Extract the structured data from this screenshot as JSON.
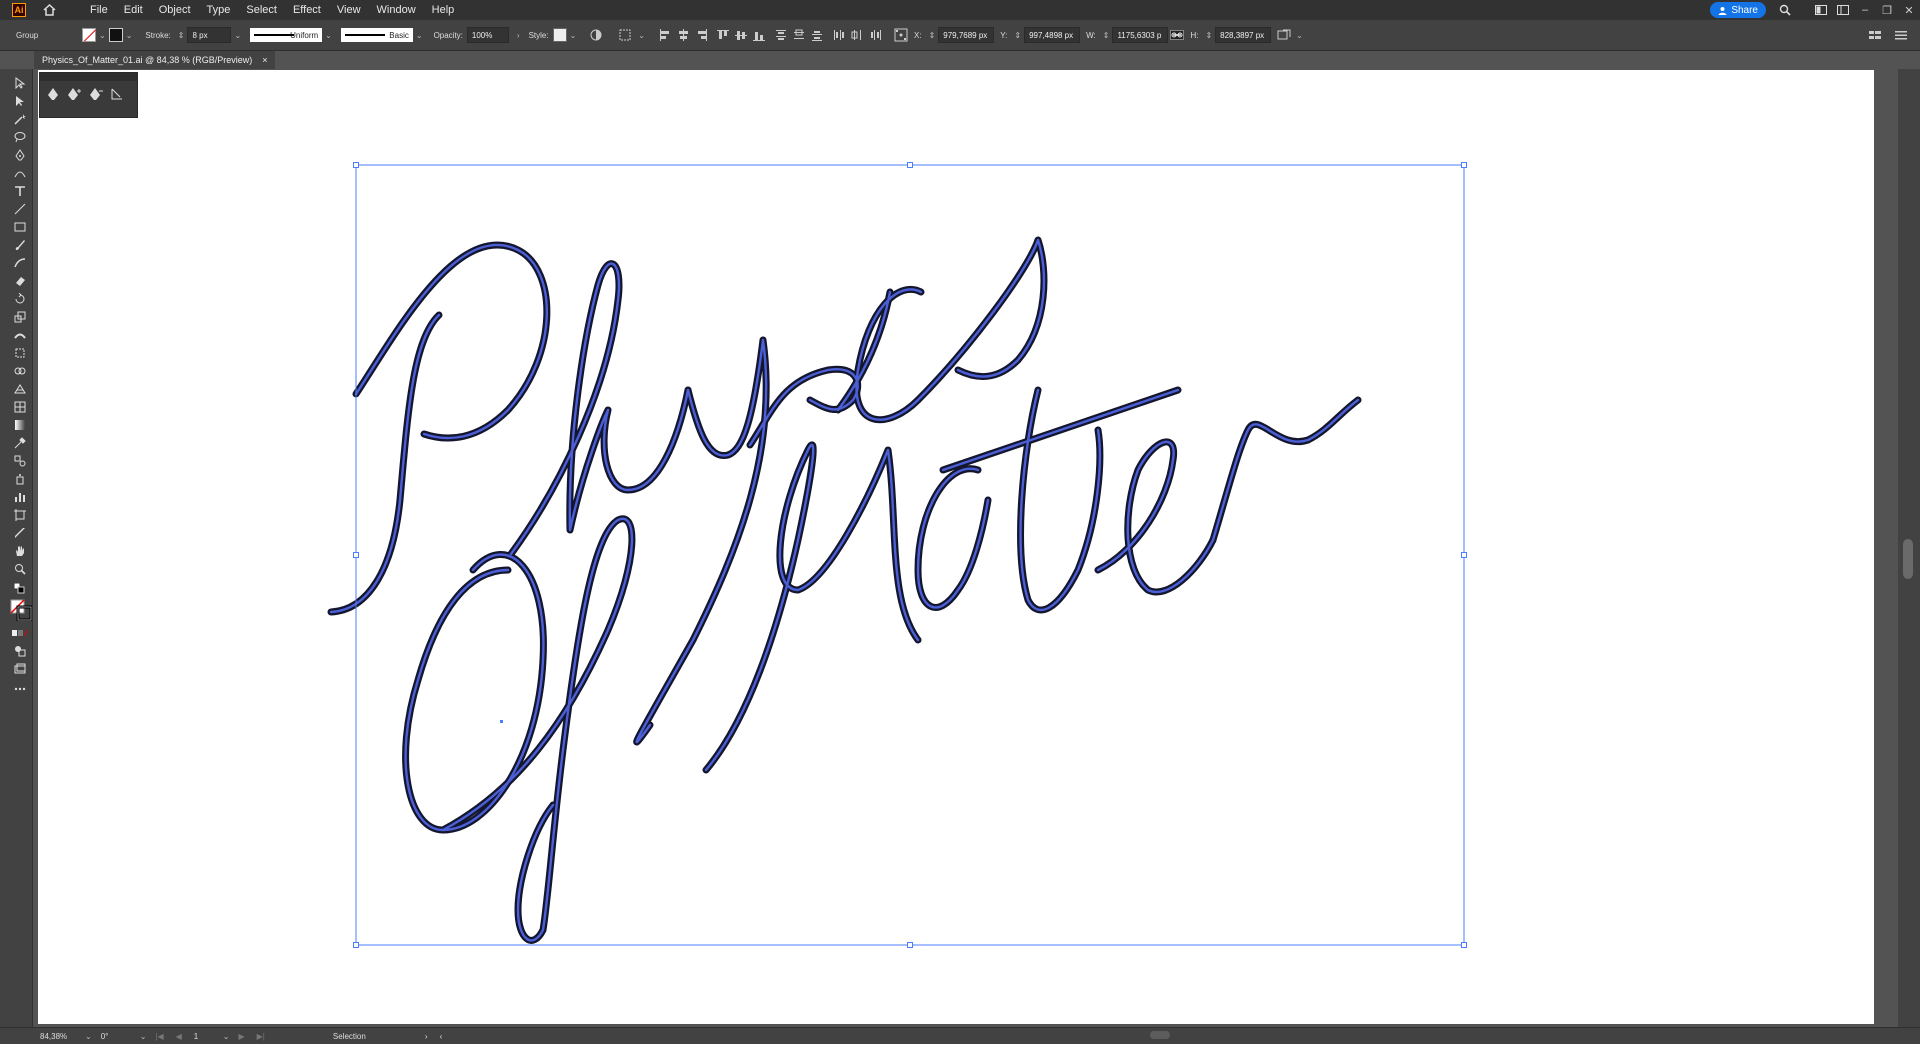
{
  "app": {
    "logo": "Ai"
  },
  "menu": [
    "File",
    "Edit",
    "Object",
    "Type",
    "Select",
    "Effect",
    "View",
    "Window",
    "Help"
  ],
  "share_label": "Share",
  "control": {
    "selection_type": "Group",
    "stroke_label": "Stroke:",
    "stroke_value": "8 px",
    "stroke_profile": "Uniform",
    "brush_label": "Basic",
    "opacity_label": "Opacity:",
    "opacity_value": "100%",
    "style_label": "Style:",
    "x_label": "X:",
    "x_value": "979,7689 px",
    "y_label": "Y:",
    "y_value": "997,4898 px",
    "w_label": "W:",
    "w_value": "1175,6303 p",
    "h_label": "H:",
    "h_value": "828,3897 px"
  },
  "document_tab": {
    "title": "Physics_Of_Matter_01.ai @ 84,38 % (RGB/Preview)",
    "close": "×"
  },
  "status": {
    "zoom": "84,38%",
    "rotation": "0°",
    "artboard": "1",
    "tool": "Selection"
  },
  "artwork": {
    "stroke_color": "#14162e",
    "highlight_color": "#4b5fd6",
    "selection_color": "#4a7dff"
  },
  "icons": {
    "home": "home-icon",
    "search": "search-icon",
    "arrange": "arrange-documents-icon",
    "workspace": "workspace-icon"
  }
}
